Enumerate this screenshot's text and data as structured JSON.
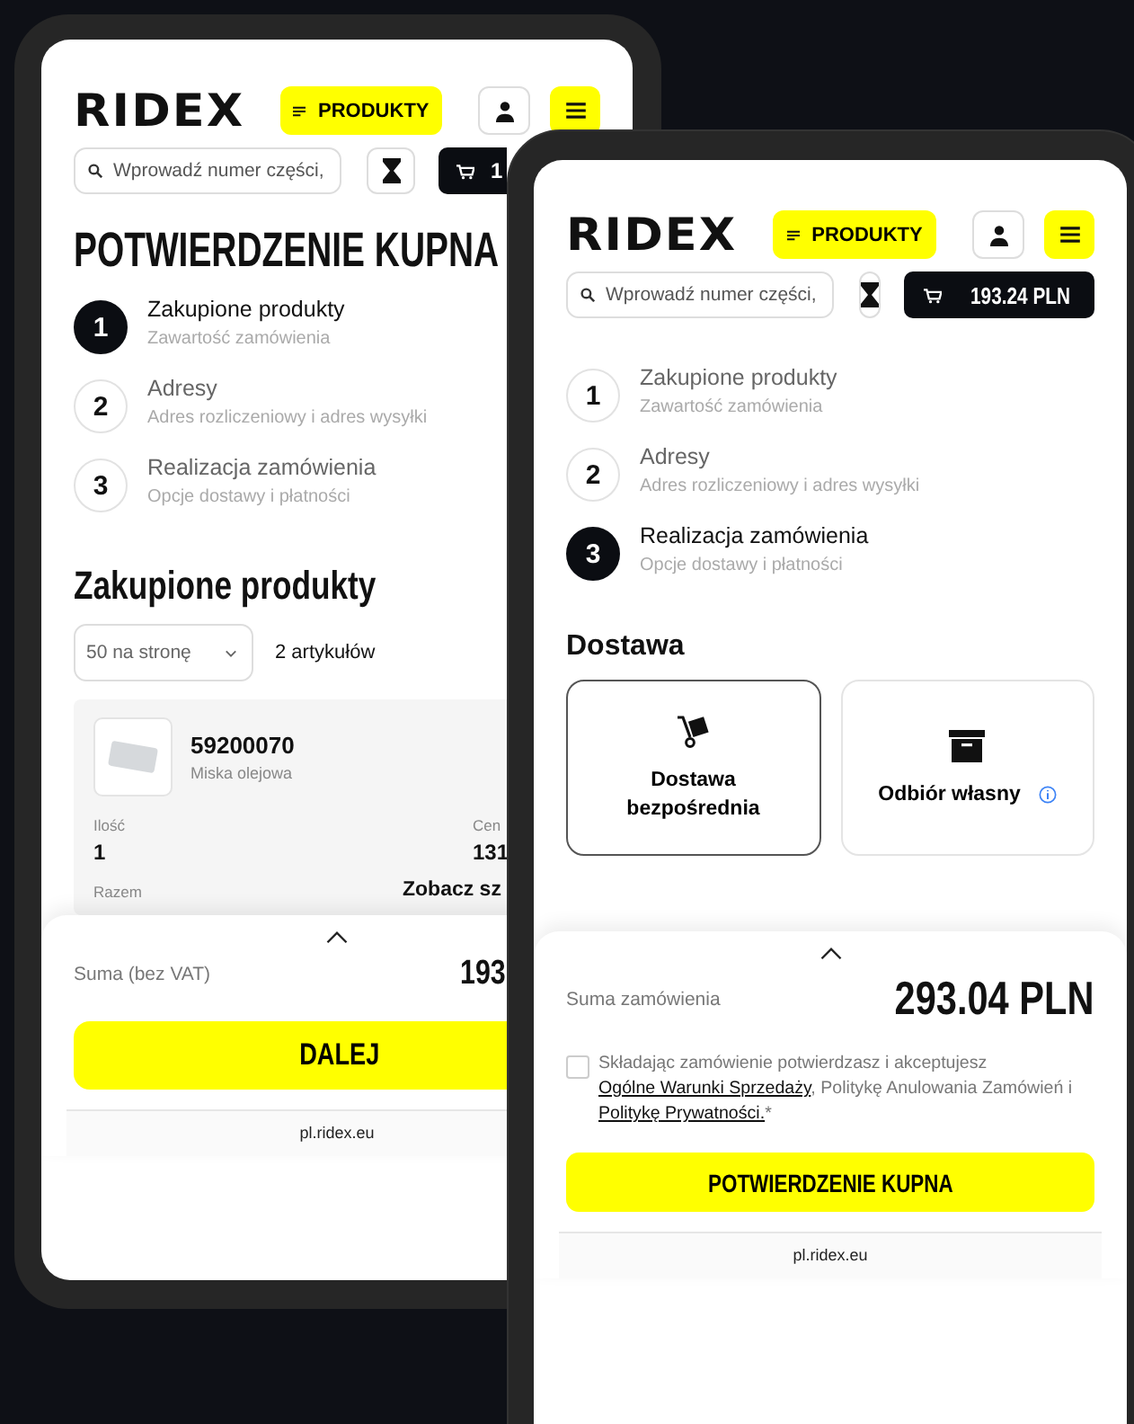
{
  "back_phone": {
    "logo": "RIDEX",
    "products_button": "PRODUKTY",
    "search": {
      "placeholder": "Wprowadź numer części,"
    },
    "cart_total": "1",
    "page_title": "POTWIERDZENIE KUPNA",
    "steps": [
      {
        "number": "1",
        "title": "Zakupione produkty",
        "subtitle": "Zawartość zamówienia",
        "selected": true
      },
      {
        "number": "2",
        "title": "Adresy",
        "subtitle": "Adres rozliczeniowy i adres wysyłki",
        "selected": false
      },
      {
        "number": "3",
        "title": "Realizacja zamówienia",
        "subtitle": "Opcje dostawy i płatności",
        "selected": false
      }
    ],
    "section_title": "Zakupione produkty",
    "per_page": "50 na stronę",
    "item_count": "2 artykułów",
    "product": {
      "number": "59200070",
      "name": "Miska olejowa",
      "quantity_label": "Ilość",
      "quantity": "1",
      "price_label": "Cen",
      "price": "131",
      "total_label": "Razem",
      "details_link": "Zobacz sz"
    },
    "summary": {
      "label": "Suma (bez VAT)",
      "value": "193"
    },
    "primary_button": "DALEJ",
    "url": "pl.ridex.eu"
  },
  "front_phone": {
    "logo": "RIDEX",
    "products_button": "PRODUKTY",
    "search": {
      "placeholder": "Wprowadź numer części,"
    },
    "cart_total": "193.24 PLN",
    "steps": [
      {
        "number": "1",
        "title": "Zakupione produkty",
        "subtitle": "Zawartość zamówienia",
        "selected": false
      },
      {
        "number": "2",
        "title": "Adresy",
        "subtitle": "Adres rozliczeniowy i adres wysyłki",
        "selected": false
      },
      {
        "number": "3",
        "title": "Realizacja zamówienia",
        "subtitle": "Opcje dostawy i płatności",
        "selected": true
      }
    ],
    "section_title": "Dostawa",
    "delivery_options": [
      {
        "kind": "courier",
        "label": "Dostawa bezpośrednia",
        "selected": true,
        "info": false
      },
      {
        "kind": "pickup",
        "label": "Odbiór własny",
        "selected": false,
        "info": true
      }
    ],
    "summary": {
      "label": "Suma zamówienia",
      "value": "293.04 PLN"
    },
    "terms": {
      "checked": false,
      "parts": [
        {
          "text": "Składając zamówienie potwierdzasz i akceptujesz ",
          "link": false
        },
        {
          "text": "Ogólne Warunki Sprzedaży",
          "link": true
        },
        {
          "text": ", Politykę Anulowania Zamówień i ",
          "link": false
        },
        {
          "text": "Politykę Prywatności.",
          "link": true
        },
        {
          "text": "*",
          "link": false
        }
      ]
    },
    "primary_button": "POTWIERDZENIE KUPNA",
    "url": "pl.ridex.eu"
  }
}
